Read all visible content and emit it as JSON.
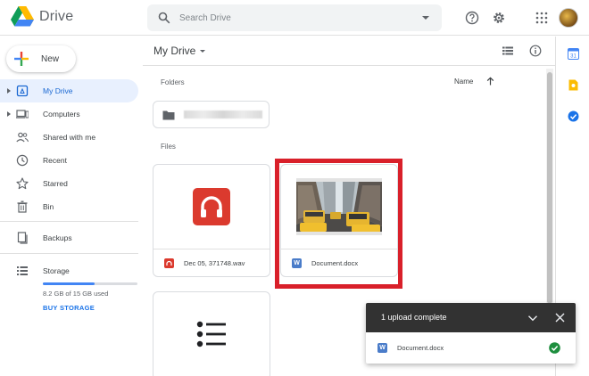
{
  "app": {
    "name": "Drive"
  },
  "search": {
    "placeholder": "Search Drive"
  },
  "sidebar": {
    "new_label": "New",
    "items": [
      {
        "label": "My Drive",
        "icon": "drive-folder-icon",
        "active": true,
        "expandable": true
      },
      {
        "label": "Computers",
        "icon": "computer-icon",
        "active": false,
        "expandable": true
      },
      {
        "label": "Shared with me",
        "icon": "people-icon",
        "active": false
      },
      {
        "label": "Recent",
        "icon": "clock-icon",
        "active": false
      },
      {
        "label": "Starred",
        "icon": "star-icon",
        "active": false
      },
      {
        "label": "Bin",
        "icon": "trash-icon",
        "active": false
      },
      {
        "label": "Backups",
        "icon": "backup-icon",
        "active": false
      },
      {
        "label": "Storage",
        "icon": "storage-icon",
        "active": false
      }
    ],
    "storage": {
      "used_text": "8.2 GB of 15 GB used",
      "used_fraction": 0.55,
      "buy_label": "BUY STORAGE"
    }
  },
  "main": {
    "title": "My Drive",
    "folders_label": "Folders",
    "sort_label": "Name",
    "files_label": "Files",
    "files": [
      {
        "name": "Dec 05, 371748.wav",
        "type": "audio",
        "type_icon": "audio-file-icon"
      },
      {
        "name": "Document.docx",
        "type": "word",
        "type_icon": "word-file-icon",
        "highlighted": true
      },
      {
        "name": "",
        "type": "list",
        "type_icon": "list-icon"
      }
    ]
  },
  "upload_toast": {
    "title": "1 upload complete",
    "item": {
      "name": "Document.docx",
      "type_icon": "word-file-icon",
      "status": "complete"
    }
  },
  "colors": {
    "accent": "#1a73e8",
    "active_bg": "#e8f0fe",
    "highlight": "#d9202a",
    "audio_red": "#db3a2e",
    "word_blue": "#4a7cc9",
    "success": "#1e8e3e"
  }
}
